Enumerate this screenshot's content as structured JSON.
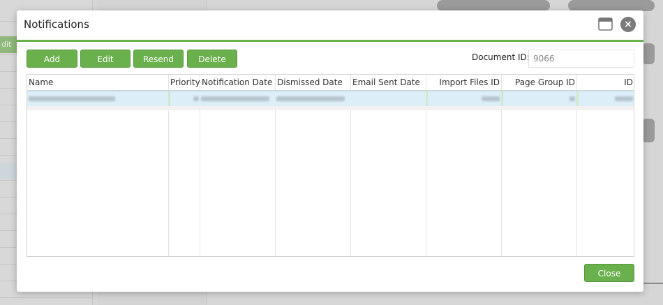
{
  "dialog": {
    "title": "Notifications",
    "close_glyph": "×"
  },
  "toolbar": {
    "add_label": "Add",
    "edit_label": "Edit",
    "resend_label": "Resend",
    "delete_label": "Delete"
  },
  "document": {
    "id_label": "Document ID:",
    "id_value": "9066"
  },
  "grid": {
    "columns": [
      "Name",
      "Priority",
      "Notification Date",
      "Dismissed Date",
      "Email Sent Date",
      "Import Files ID",
      "Page Group ID",
      "ID"
    ],
    "rows_note_hidden": true
  },
  "footer": {
    "close_label": "Close"
  },
  "background": {
    "edit_label": "dit"
  },
  "colors": {
    "accent": "#6ab04c",
    "selected_row": "#dceef7"
  }
}
